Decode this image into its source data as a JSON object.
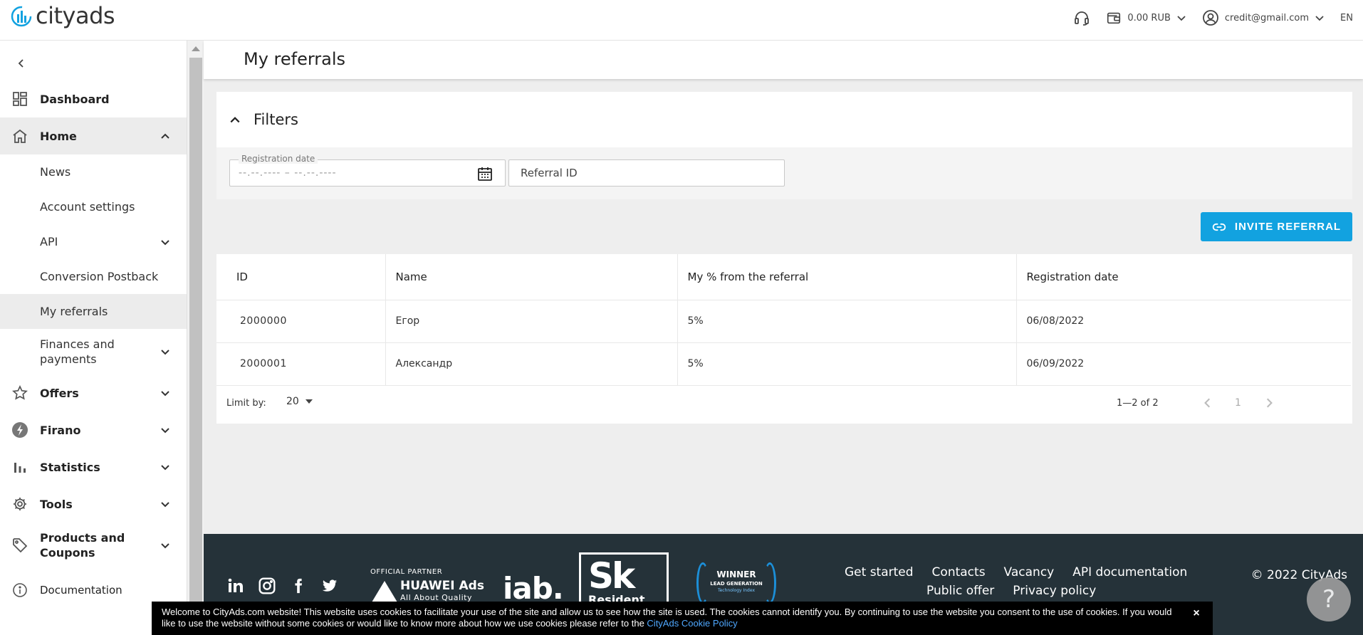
{
  "brand": {
    "logo_text": "cityads",
    "accent": "#12a2e0"
  },
  "header": {
    "support_icon": "headset-icon",
    "balance": "0.00 RUB",
    "account_email": "credit@gmail.com",
    "language": "EN"
  },
  "sidebar": {
    "items": [
      {
        "label": "Dashboard",
        "icon": "dashboard-icon"
      },
      {
        "label": "Home",
        "icon": "home-icon"
      },
      {
        "label": "News"
      },
      {
        "label": "Account settings"
      },
      {
        "label": "API"
      },
      {
        "label": "Conversion Postback"
      },
      {
        "label": "My referrals"
      },
      {
        "label": "Finances and payments"
      },
      {
        "label": "Offers",
        "icon": "star-icon"
      },
      {
        "label": "Firano",
        "icon": "firano-icon"
      },
      {
        "label": "Statistics",
        "icon": "bar-chart-icon"
      },
      {
        "label": "Tools",
        "icon": "gear-icon"
      },
      {
        "label": "Products and Coupons",
        "icon": "tag-icon"
      },
      {
        "label": "Documentation",
        "icon": "info-icon"
      }
    ]
  },
  "page": {
    "title": "My referrals",
    "filters": {
      "title": "Filters",
      "registration_date_label": "Registration date",
      "registration_date_value": "--.--.---- – --.--.----",
      "referral_id_placeholder": "Referral ID"
    },
    "invite_button": "INVITE REFERRAL",
    "table": {
      "columns": [
        "ID",
        "Name",
        "My % from the referral",
        "Registration date"
      ],
      "rows": [
        {
          "id": "2000000",
          "name": "Егор",
          "percent": "5%",
          "date": "06/08/2022"
        },
        {
          "id": "2000001",
          "name": "Александр",
          "percent": "5%",
          "date": "06/09/2022"
        }
      ]
    },
    "pager": {
      "limit_label": "Limit by:",
      "limit_value": "20",
      "range": "1—2 of 2",
      "current_page": "1"
    }
  },
  "footer": {
    "partner_top": "OFFICIAL PARTNER",
    "partner_main": "HUAWEI Ads",
    "partner_sub": "All About Quality",
    "iab": "iab.",
    "sk_big": "Sk",
    "sk_small": "Resident",
    "winner_t1": "WINNER",
    "winner_t2": "LEAD GENERATION",
    "winner_t3": "Technology Index",
    "links_row1": [
      "Get started",
      "Contacts",
      "Vacancy",
      "API documentation"
    ],
    "links_row2": [
      "Public offer",
      "Privacy policy"
    ],
    "copyright": "© 2022 CityAds",
    "help": "?"
  },
  "cookie": {
    "text": "Welcome to CityAds.com website! This website uses cookies to facilitate your use of the site and allow us to see how the site is used. The cookies cannot identify you. By continuing to use the website you consent to the use of cookies. If you would like to use the website without some cookies or would like to know more about how we use cookies please refer to the ",
    "link": "CityAds Cookie Policy",
    "close": "×"
  }
}
